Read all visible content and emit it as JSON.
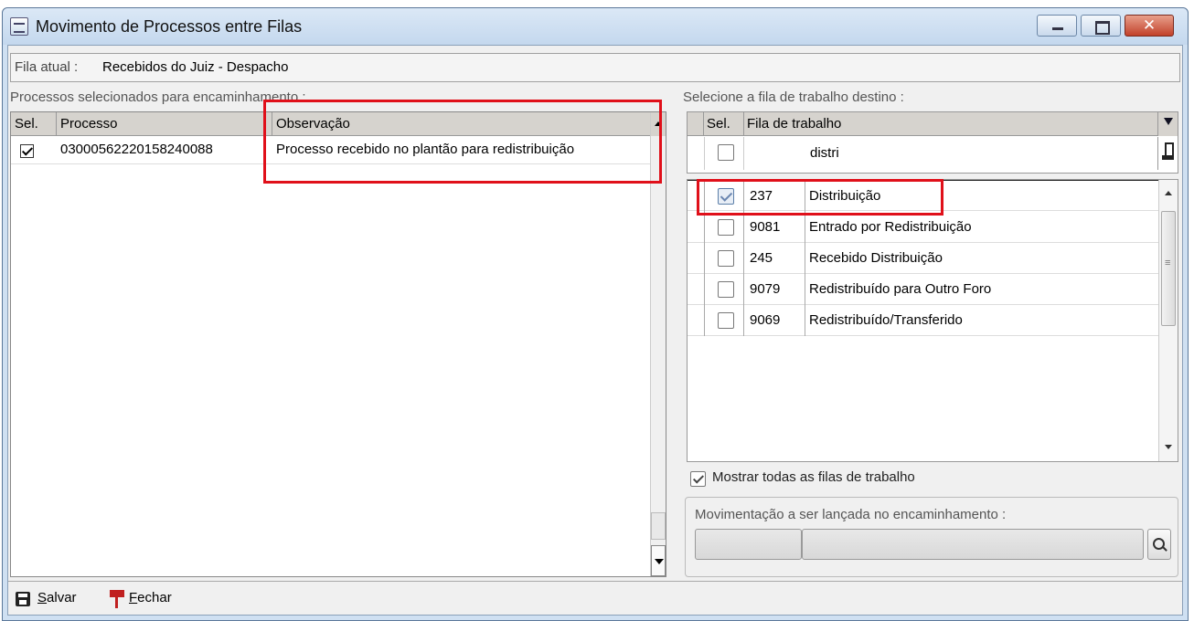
{
  "window": {
    "title": "Movimento de Processos entre Filas"
  },
  "fila": {
    "label": "Fila atual :",
    "value": "Recebidos do Juiz - Despacho"
  },
  "left_panel": {
    "label": "Processos selecionados para encaminhamento :",
    "columns": [
      "Sel.",
      "Processo",
      "Observação"
    ],
    "rows": [
      {
        "selected": true,
        "processo": "03000562220158240088",
        "observacao": "Processo recebido no plantão para redistribuição"
      }
    ]
  },
  "right_panel": {
    "label": "Selecione a fila de trabalho destino :",
    "columns": [
      "Sel.",
      "Fila de trabalho"
    ],
    "filter_value": "distri",
    "rows": [
      {
        "selected": true,
        "code": "237",
        "name": "Distribuição"
      },
      {
        "selected": false,
        "code": "9081",
        "name": "Entrado por Redistribuição"
      },
      {
        "selected": false,
        "code": "245",
        "name": "Recebido Distribuição"
      },
      {
        "selected": false,
        "code": "9079",
        "name": "Redistribuído para Outro Foro"
      },
      {
        "selected": false,
        "code": "9069",
        "name": "Redistribuído/Transferido"
      }
    ],
    "show_all_label": "Mostrar todas as filas de trabalho",
    "show_all_checked": true
  },
  "movimentacao": {
    "label": "Movimentação a ser lançada no encaminhamento :",
    "code_value": "",
    "desc_value": ""
  },
  "toolbar": {
    "save_label": "Salvar",
    "close_label": "Fechar"
  },
  "icons": [
    "window-icon",
    "minimize-icon",
    "maximize-icon",
    "close-icon",
    "filter-icon",
    "brush-icon",
    "search-icon",
    "save-icon",
    "close-flag-icon"
  ],
  "colors": {
    "titlebar": "#c4d8ee",
    "close_button": "#c2412a",
    "annotation_red": "#e0101a",
    "grid_header": "#d6d3ce"
  }
}
